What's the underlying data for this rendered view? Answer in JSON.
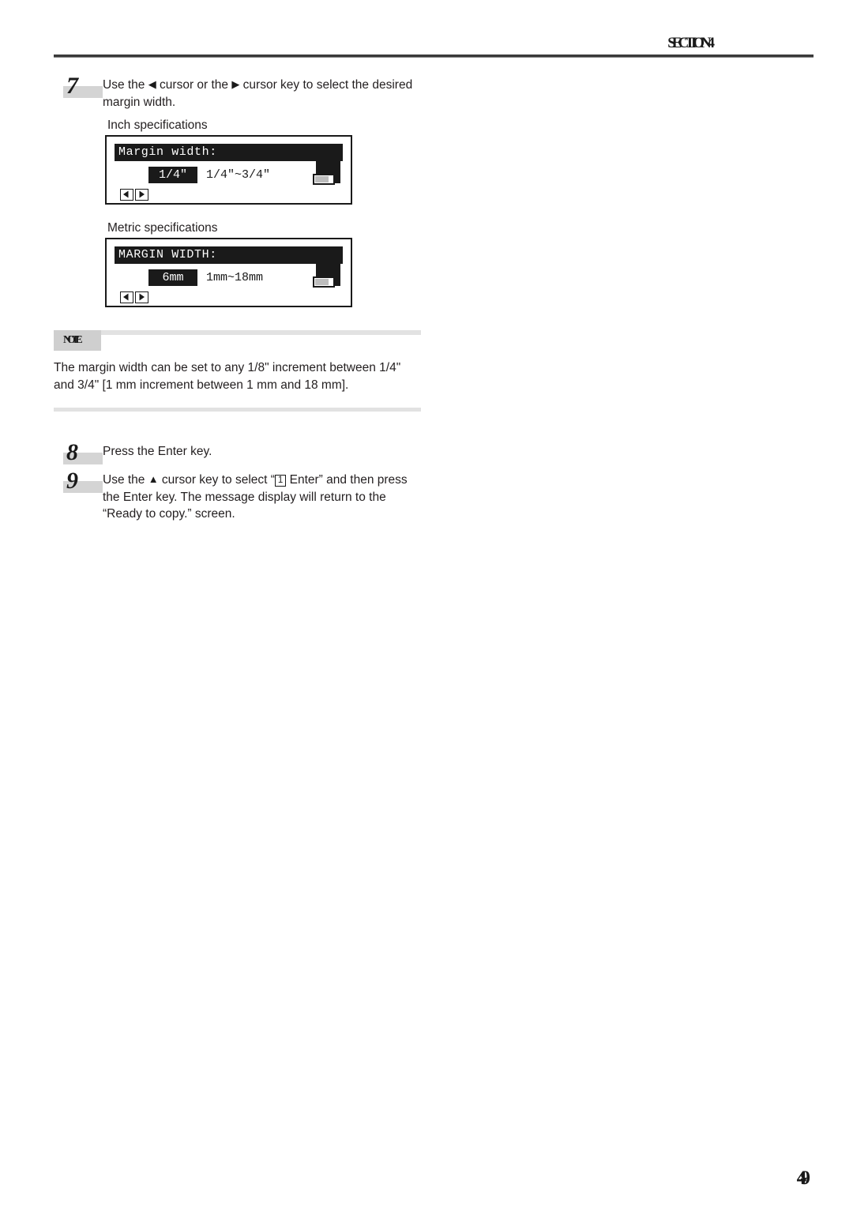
{
  "header": {
    "title": "SECTION 4"
  },
  "steps": [
    {
      "number": "7",
      "text_before_left": "Use the ",
      "left_arrow": "◀",
      "text_middle": " cursor or the ",
      "right_arrow": "▶",
      "text_after": " cursor key to select the desired margin width."
    },
    {
      "number": "8",
      "text": "Press the Enter key."
    },
    {
      "number": "9",
      "text_before_up": "Use the ",
      "up_arrow": "▲",
      "text_middle": " cursor key to select “",
      "boxed_number": "1",
      "text_after": " Enter” and then press the Enter key. The message display will return to the “Ready to copy.” screen."
    }
  ],
  "labels": {
    "inch_specifications": "Inch specifications",
    "metric_specifications": "Metric specifications"
  },
  "lcd_panels": [
    {
      "name": "inch",
      "title": "Margin width:",
      "value": "1/4\"",
      "range": "1/4\"~3/4\"",
      "cursor_left": "left-cursor-key",
      "cursor_right": "right-cursor-key",
      "icon": "paper-tray-icon"
    },
    {
      "name": "metric",
      "title": "MARGIN WIDTH:",
      "value": "6mm",
      "range": "1mm~18mm",
      "cursor_left": "left-cursor-key",
      "cursor_right": "right-cursor-key",
      "icon": "paper-tray-icon"
    }
  ],
  "note": {
    "tab_label": "NOTE",
    "body": "The margin width can be set to any 1/8\" increment between 1/4\" and 3/4\" [1 mm increment between 1 mm and 18 mm]."
  },
  "folio": {
    "page_number": "4-9"
  },
  "colors": {
    "ink": "#231f20",
    "lcd_black": "#1a1a1a",
    "step_bar_gray": "#d4d4d4",
    "note_tab_gray": "#cfcfcf",
    "note_rule_gray": "#e2e2e2"
  }
}
